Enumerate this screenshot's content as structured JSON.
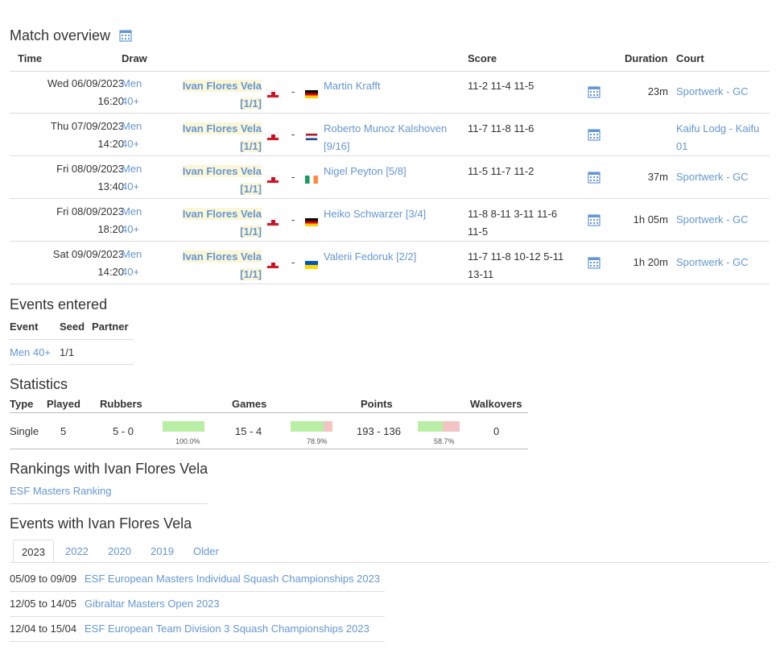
{
  "match_overview": {
    "title": "Match overview",
    "headers": {
      "time": "Time",
      "draw": "Draw",
      "score": "Score",
      "duration": "Duration",
      "court": "Court"
    },
    "rows": [
      {
        "date": "Wed 06/09/2023",
        "time": "16:20",
        "draw1": "Men",
        "draw2": "40+",
        "player1": "Ivan Flores Vela",
        "seed1": "[1/1]",
        "flag1": "gi",
        "dash": "-",
        "flag2": "de",
        "player2": "Martin Krafft",
        "score": "11-2 11-4 11-5",
        "duration": "23m",
        "court": "Sportwerk - GC"
      },
      {
        "date": "Thu 07/09/2023",
        "time": "14:20",
        "draw1": "Men",
        "draw2": "40+",
        "player1": "Ivan Flores Vela",
        "seed1": "[1/1]",
        "flag1": "gi",
        "dash": "-",
        "flag2": "nl",
        "player2": "Roberto Munoz Kalshoven [9/16]",
        "score": "11-7 11-8 11-6",
        "duration": "",
        "court": "Kaifu Lodg - Kaifu 01"
      },
      {
        "date": "Fri 08/09/2023",
        "time": "13:40",
        "draw1": "Men",
        "draw2": "40+",
        "player1": "Ivan Flores Vela",
        "seed1": "[1/1]",
        "flag1": "gi",
        "dash": "-",
        "flag2": "ie",
        "player2": "Nigel Peyton [5/8]",
        "score": "11-5 11-7 11-2",
        "duration": "37m",
        "court": "Sportwerk - GC"
      },
      {
        "date": "Fri 08/09/2023",
        "time": "18:20",
        "draw1": "Men",
        "draw2": "40+",
        "player1": "Ivan Flores Vela",
        "seed1": "[1/1]",
        "flag1": "gi",
        "dash": "-",
        "flag2": "de",
        "player2": "Heiko Schwarzer [3/4]",
        "score": "11-8 8-11 3-11 11-6 11-5",
        "duration": "1h 05m",
        "court": "Sportwerk - GC"
      },
      {
        "date": "Sat 09/09/2023",
        "time": "14:20",
        "draw1": "Men",
        "draw2": "40+",
        "player1": "Ivan Flores Vela",
        "seed1": "[1/1]",
        "flag1": "gi",
        "dash": "-",
        "flag2": "ua",
        "player2": "Valerii Fedoruk [2/2]",
        "score": "11-7 11-8 10-12 5-11 13-11",
        "duration": "1h 20m",
        "court": "Sportwerk - GC"
      }
    ]
  },
  "events_entered": {
    "title": "Events entered",
    "headers": {
      "event": "Event",
      "seed": "Seed",
      "partner": "Partner"
    },
    "rows": [
      {
        "event": "Men 40+",
        "seed": "1/1",
        "partner": ""
      }
    ]
  },
  "statistics": {
    "title": "Statistics",
    "headers": {
      "type": "Type",
      "played": "Played",
      "rubbers": "Rubbers",
      "games": "Games",
      "points": "Points",
      "walkovers": "Walkovers"
    },
    "row": {
      "type": "Single",
      "played": "5",
      "rubbers": "5 - 0",
      "rubbers_pct_label": "100.0%",
      "rubbers_pct": 100.0,
      "games": "15 - 4",
      "games_pct_label": "78.9%",
      "games_pct": 78.9,
      "points": "193 - 136",
      "points_pct_label": "58.7%",
      "points_pct": 58.7,
      "walkovers": "0"
    },
    "colors": {
      "win": "#b9efa5",
      "loss": "#f2c4c4"
    }
  },
  "rankings": {
    "title": "Rankings with Ivan Flores Vela",
    "items": [
      "ESF Masters Ranking"
    ]
  },
  "events_with": {
    "title": "Events with Ivan Flores Vela",
    "tabs": [
      "2023",
      "2022",
      "2020",
      "2019",
      "Older"
    ],
    "active_tab": "2023",
    "rows": [
      {
        "dates": "05/09 to 09/09",
        "name": "ESF European Masters Individual Squash Championships 2023"
      },
      {
        "dates": "12/05 to 14/05",
        "name": "Gibraltar Masters Open 2023"
      },
      {
        "dates": "12/04 to 15/04",
        "name": "ESF European Team Division 3 Squash Championships 2023"
      }
    ]
  },
  "colors": {
    "link": "#6496d4",
    "highlight": "#fbf6d5",
    "text": "#333333"
  },
  "icons": {
    "calendar": "calendar-icon"
  }
}
